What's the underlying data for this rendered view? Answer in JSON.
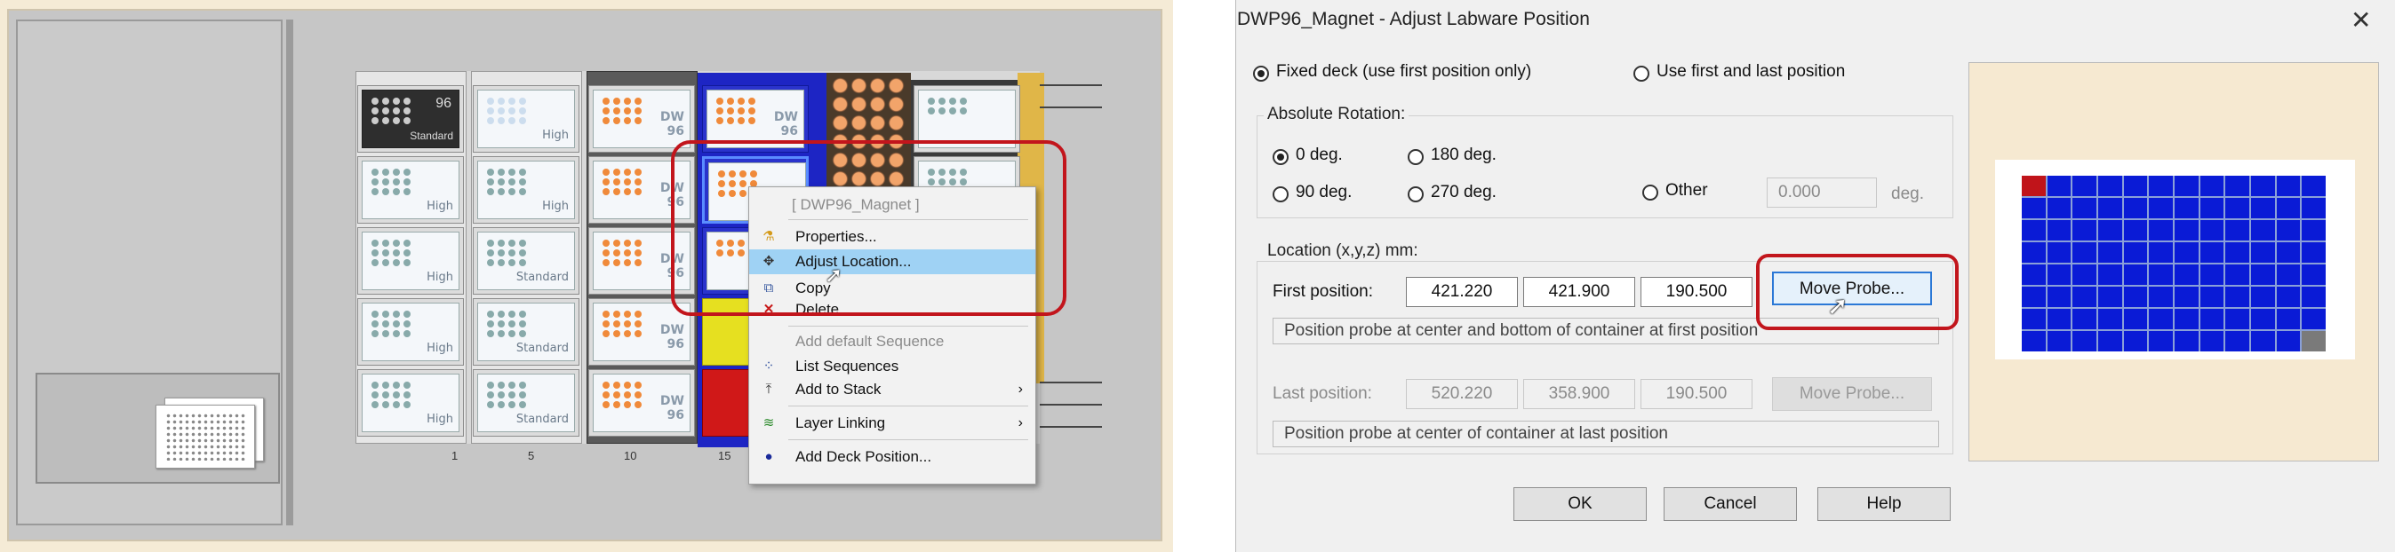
{
  "left_panel": {
    "plate_labels": {
      "standard_dark": [
        "96",
        "Standard"
      ],
      "high": "High",
      "standard": "Standard",
      "dw": [
        "DW",
        "96"
      ]
    },
    "column_ticks": [
      "1",
      "5",
      "10",
      "15"
    ],
    "context_menu": {
      "header": "[ DWP96_Magnet ]",
      "items": [
        {
          "label": "Properties...",
          "icon": "flask-icon",
          "enabled": true
        },
        {
          "label": "Adjust Location...",
          "icon": "move-arrows-icon",
          "enabled": true,
          "highlighted": true
        },
        {
          "label": "Copy",
          "icon": "copy-icon",
          "enabled": true
        },
        {
          "label": "Delete",
          "icon": "delete-x-icon",
          "enabled": true
        },
        {
          "label": "Add default Sequence",
          "icon": "",
          "enabled": false
        },
        {
          "label": "List Sequences",
          "icon": "sequence-dots-icon",
          "enabled": true
        },
        {
          "label": "Add to Stack",
          "icon": "stack-icon",
          "enabled": true,
          "submenu": true
        },
        {
          "label": "Layer Linking",
          "icon": "layer-link-icon",
          "enabled": true,
          "submenu": true
        },
        {
          "label": "Add Deck Position...",
          "icon": "deck-position-dot-icon",
          "enabled": true
        }
      ]
    }
  },
  "dialog": {
    "title": "DWP96_Magnet - Adjust Labware Position",
    "close_glyph": "✕",
    "mode": {
      "fixed_deck_label": "Fixed deck (use first position only)",
      "first_last_label": "Use first and last position",
      "selected": "fixed_deck"
    },
    "rotation": {
      "group_label": "Absolute Rotation:",
      "options": [
        "0 deg.",
        "180 deg.",
        "90 deg.",
        "270 deg.",
        "Other"
      ],
      "selected": "0 deg.",
      "other_value": "0.000",
      "other_unit": "deg."
    },
    "location": {
      "group_label": "Location (x,y,z) mm:",
      "first_label": "First position:",
      "first_x": "421.220",
      "first_y": "421.900",
      "first_z": "190.500",
      "first_hint": "Position probe at center and bottom of container at first position",
      "last_label": "Last position:",
      "last_x": "520.220",
      "last_y": "358.900",
      "last_z": "190.500",
      "last_hint": "Position probe at center of container at last position",
      "move_probe_label": "Move Probe..."
    },
    "buttons": {
      "ok": "OK",
      "cancel": "Cancel",
      "help": "Help"
    },
    "preview": {
      "plate_color": "#0a1bd6",
      "first_well_color": "#c0141a",
      "last_well_color": "#7a7a7a",
      "rows": 8,
      "cols": 12
    }
  },
  "colors": {
    "highlight_red": "#c2151c",
    "menu_highlight": "#9fd2f4",
    "deck_blue": "#1d25c4"
  }
}
